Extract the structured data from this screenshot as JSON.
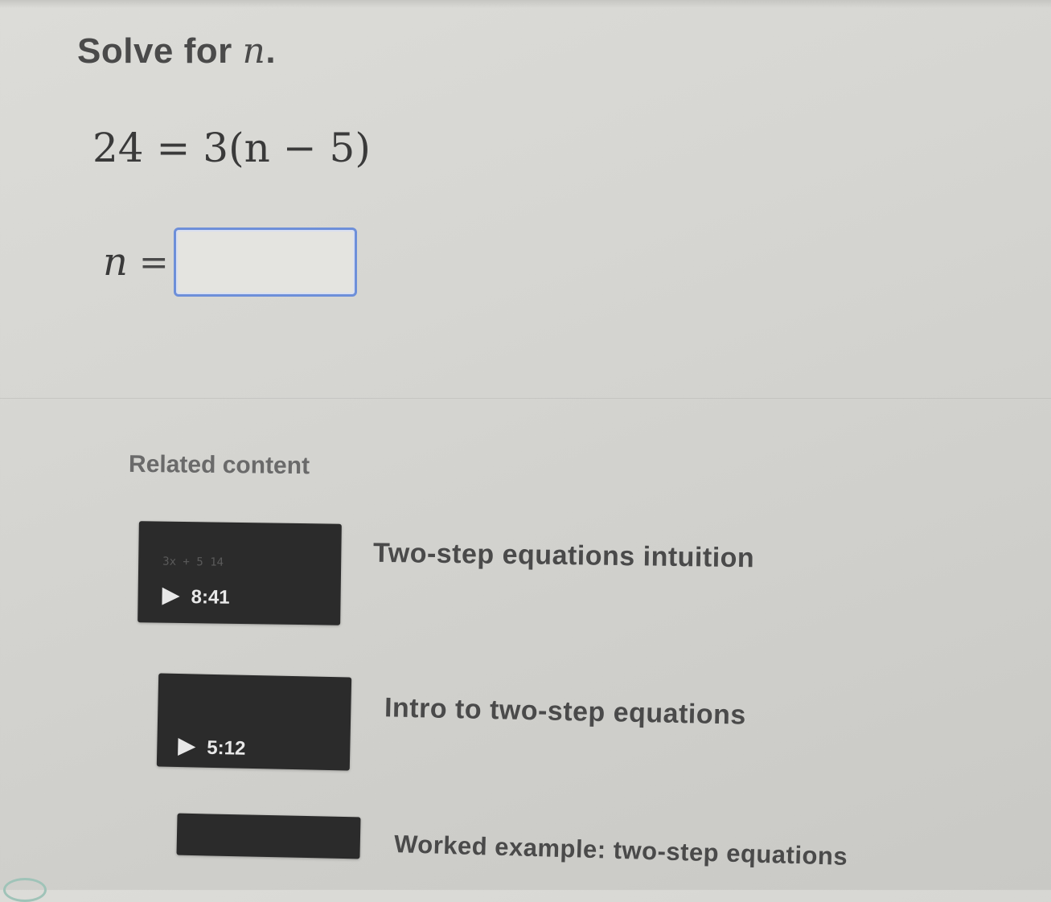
{
  "question": {
    "prompt_prefix": "Solve for ",
    "prompt_variable": "n",
    "prompt_suffix": ".",
    "equation": "24 = 3(n − 5)",
    "answer_lhs": "n",
    "answer_equals": "=",
    "answer_value": ""
  },
  "related": {
    "heading": "Related content",
    "items": [
      {
        "title": "Two-step equations intuition",
        "duration": "8:41",
        "thumb_text": "3x + 5    14"
      },
      {
        "title": "Intro to two-step equations",
        "duration": "5:12",
        "thumb_text": ""
      },
      {
        "title": "Worked example: two-step equations",
        "duration": "",
        "thumb_text": ""
      }
    ]
  },
  "colors": {
    "input_border": "#6d8fd9",
    "thumbnail_bg": "#2b2b2b",
    "page_bg": "#d6d6d2"
  },
  "icons": [
    "play-icon",
    "play-icon"
  ]
}
